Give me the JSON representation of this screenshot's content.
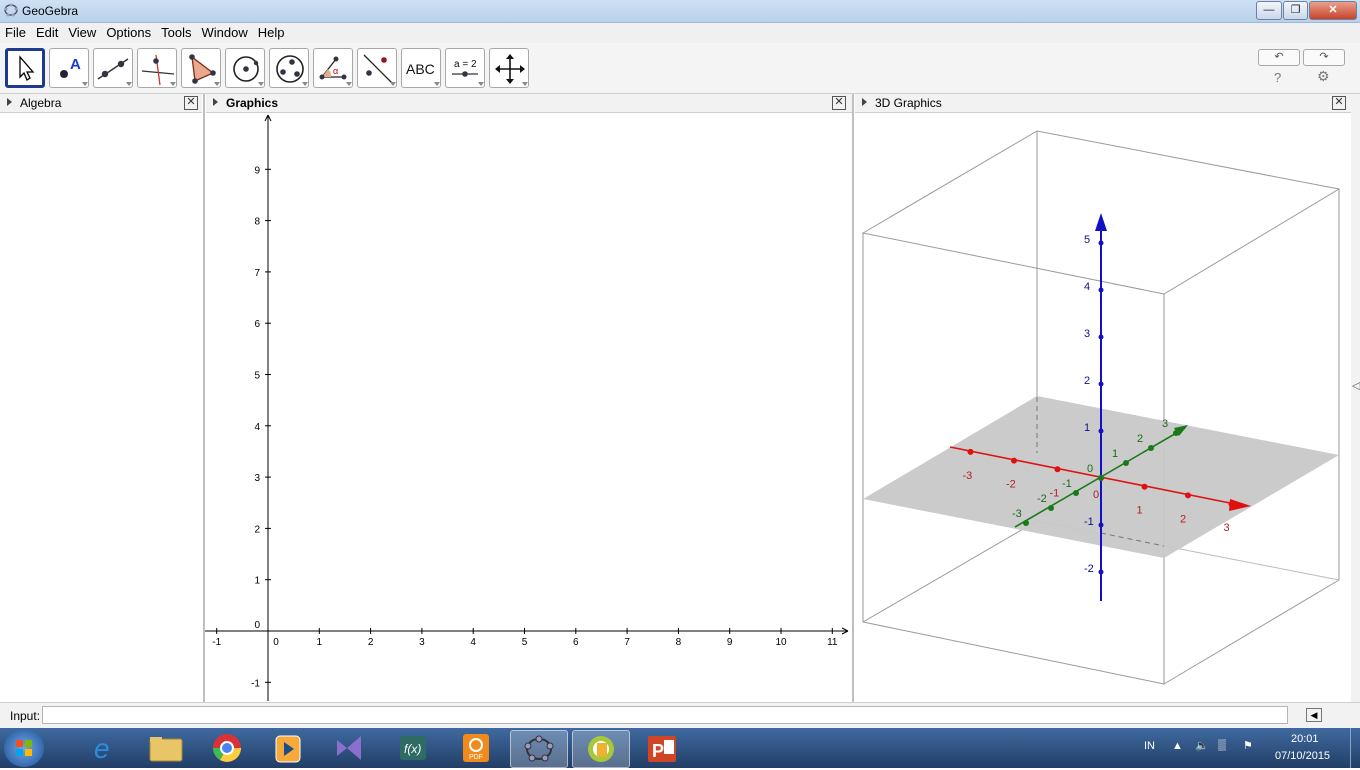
{
  "window": {
    "title": "GeoGebra"
  },
  "menu": [
    "File",
    "Edit",
    "View",
    "Options",
    "Tools",
    "Window",
    "Help"
  ],
  "toolbar": {
    "tools": [
      "move-tool",
      "point-tool",
      "line-tool",
      "perpendicular-line-tool",
      "polygon-tool",
      "circle-tool",
      "circle-three-points-tool",
      "angle-tool",
      "reflect-tool",
      "text-tool",
      "slider-tool",
      "move-view-tool"
    ],
    "text_tool_label": "ABC",
    "slider_tool_label": "a = 2",
    "help_label": "?"
  },
  "panels": {
    "algebra": {
      "title": "Algebra"
    },
    "graphics": {
      "title": "Graphics",
      "x_ticks": [
        "-1",
        "0",
        "1",
        "2",
        "3",
        "4",
        "5",
        "6",
        "7",
        "8",
        "9",
        "10",
        "11"
      ],
      "y_ticks": [
        "9",
        "8",
        "7",
        "6",
        "5",
        "4",
        "3",
        "2",
        "1",
        "0",
        "-1"
      ]
    },
    "graphics3d": {
      "title": "3D Graphics",
      "x_labels": [
        "-3",
        "-2",
        "-1",
        "0",
        "1",
        "2",
        "3"
      ],
      "y_labels": [
        "-3",
        "-2",
        "-1",
        "0",
        "1",
        "2",
        "3"
      ],
      "z_labels": [
        "5",
        "4",
        "3",
        "2",
        "1",
        "-1",
        "-2"
      ],
      "colors": {
        "x_axis": "#e01010",
        "y_axis": "#1a7a1a",
        "z_axis": "#1010c8",
        "plane": "#c8c8c8"
      }
    }
  },
  "input_bar": {
    "label": "Input:",
    "value": ""
  },
  "taskbar": {
    "apps": [
      "start-button",
      "internet-explorer",
      "file-explorer",
      "chrome",
      "media-player",
      "visual-studio",
      "formula-app",
      "pdf-app",
      "geogebra",
      "geogebra-classic",
      "powerpoint"
    ],
    "language": "IN",
    "time": "20:01",
    "date": "07/10/2015"
  }
}
